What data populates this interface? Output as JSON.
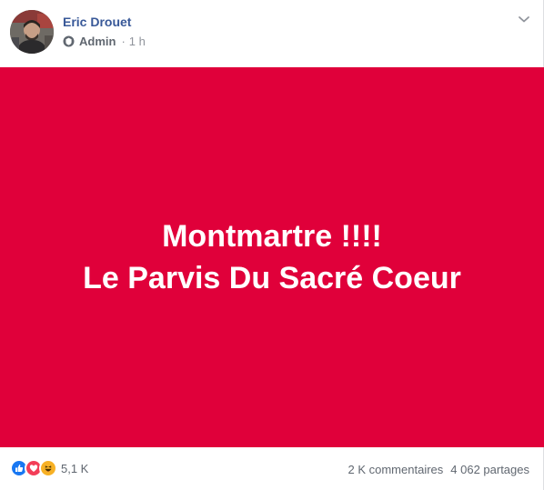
{
  "post": {
    "author": "Eric Drouet",
    "role": "Admin",
    "separator": "·",
    "time": "1 h",
    "banner_lines": [
      "Montmartre !!!!",
      "Le Parvis Du Sacré Coeur"
    ],
    "background_color": "#e0003a"
  },
  "footer": {
    "reactions": [
      "like",
      "love",
      "haha"
    ],
    "reaction_count": "5,1 K",
    "comments": "2 K commentaires",
    "shares": "4 062 partages"
  },
  "colors": {
    "author_link": "#385898",
    "meta_text": "#606770",
    "like_blue": "#1877f2",
    "love_red": "#f33e58",
    "haha_yellow": "#f7b125"
  },
  "icons": {
    "admin": "shield-icon",
    "menu": "chevron-down-icon"
  }
}
